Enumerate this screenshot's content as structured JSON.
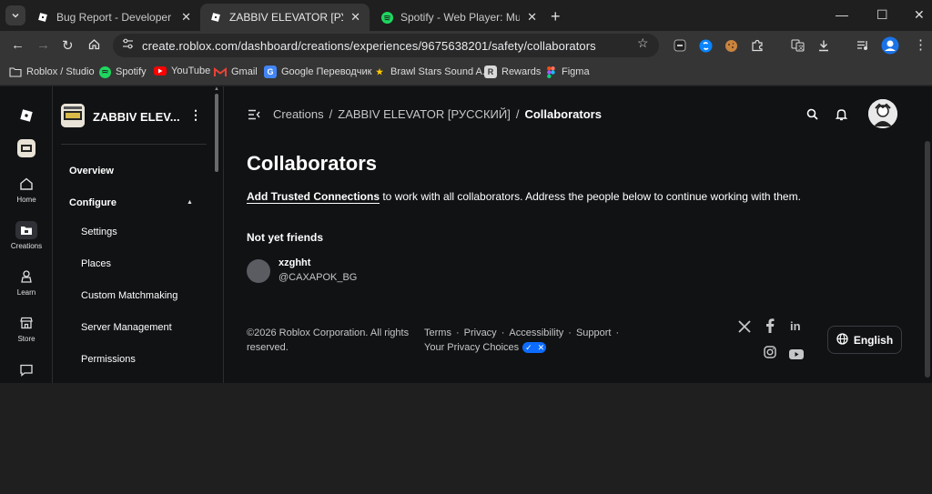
{
  "browser": {
    "tabs": [
      {
        "title": "Bug Report - Developer Forum",
        "active": false
      },
      {
        "title": "ZABBIV ELEVATOR [РУССКИЙ] /",
        "active": true
      },
      {
        "title": "Spotify - Web Player: Music for",
        "active": false
      }
    ],
    "url": "create.roblox.com/dashboard/creations/experiences/9675638201/safety/collaborators",
    "bookmarks": [
      "Roblox / Studio",
      "Spotify",
      "YouTube",
      "Gmail",
      "Google Переводчик",
      "Brawl Stars Sound A...",
      "Rewards",
      "Figma"
    ]
  },
  "rail": {
    "items": [
      {
        "label": "Home",
        "icon": "home-icon"
      },
      {
        "label": "Creations",
        "icon": "folder-icon"
      },
      {
        "label": "Learn",
        "icon": "learn-icon"
      },
      {
        "label": "Store",
        "icon": "store-icon"
      }
    ]
  },
  "sidebar": {
    "experience_name": "ZABBIV ELEV...",
    "overview": "Overview",
    "configure": "Configure",
    "items": [
      "Settings",
      "Places",
      "Custom Matchmaking",
      "Server Management",
      "Permissions"
    ]
  },
  "main": {
    "breadcrumbs": [
      "Creations",
      "ZABBIV ELEVATOR [РУССКИЙ]",
      "Collaborators"
    ],
    "title": "Collaborators",
    "desc_link": "Add Trusted Connections",
    "desc_rest": " to work with all collaborators. Address the people below to continue working with them.",
    "section_title": "Not yet friends",
    "collaborator": {
      "name": "xzghht",
      "handle": "@CAXAPOK_BG"
    }
  },
  "footer": {
    "copyright": "©2026 Roblox Corporation. All rights reserved.",
    "links": [
      "Terms",
      "Privacy",
      "Accessibility",
      "Support"
    ],
    "privacy_choices": "Your Privacy Choices",
    "language": "English"
  },
  "colors": {
    "accent_blue": "#0b6cff",
    "page_bg": "#111214"
  }
}
